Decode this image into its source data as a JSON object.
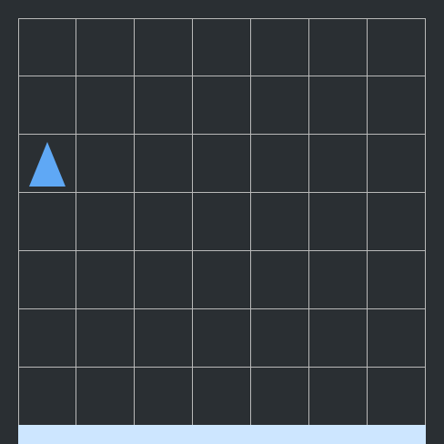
{
  "board": {
    "rows": 7,
    "cols": 7,
    "pieces": [
      {
        "type": "triangle",
        "row": 2,
        "col": 0,
        "color": "#5fa8f5",
        "icon": "triangle-piece-icon"
      }
    ]
  },
  "colors": {
    "background": "#2a2f33",
    "grid_line": "#b9b9b9",
    "bottom_bar": "#cde6ff"
  }
}
